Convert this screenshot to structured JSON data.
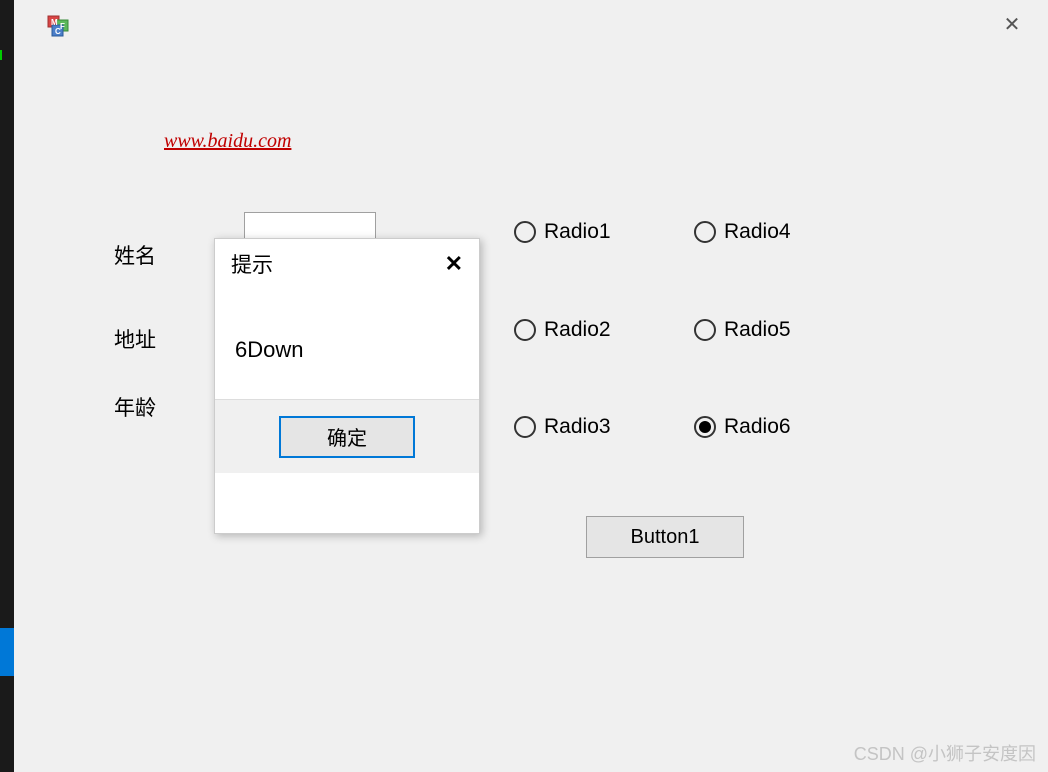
{
  "window": {
    "close_icon": "✕"
  },
  "link": {
    "text": "www.baidu.com"
  },
  "labels": {
    "name": "姓名",
    "address": "地址",
    "age": "年龄"
  },
  "radios": {
    "r1": "Radio1",
    "r2": "Radio2",
    "r3": "Radio3",
    "r4": "Radio4",
    "r5": "Radio5",
    "r6": "Radio6",
    "selected": "r6"
  },
  "button1": {
    "label": "Button1"
  },
  "msgbox": {
    "title": "提示",
    "close_icon": "✕",
    "message": "6Down",
    "ok_label": "确定"
  },
  "watermark": "CSDN @小狮子安度因"
}
